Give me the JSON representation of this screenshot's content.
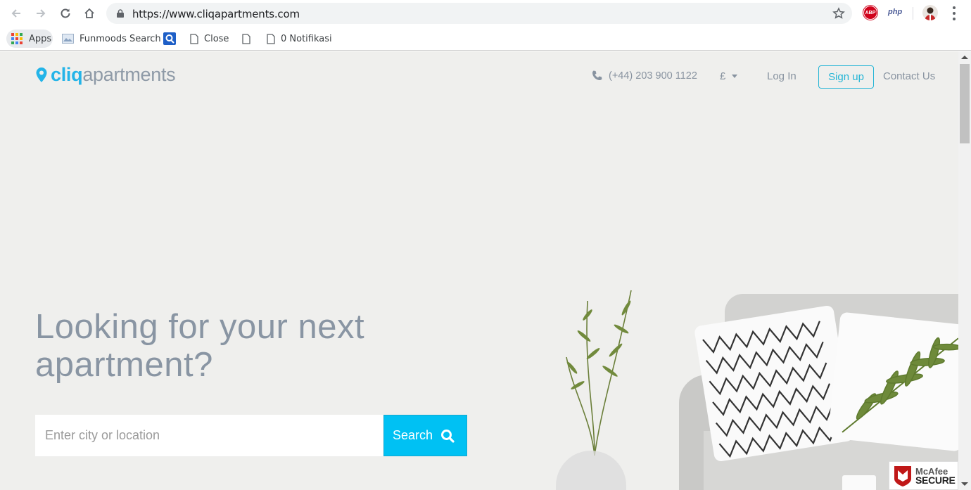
{
  "browser": {
    "url": "https://www.cliqapartments.com",
    "extensions": {
      "abp": "ABP",
      "php": "php"
    }
  },
  "bookmarks": {
    "apps": "Apps",
    "items": [
      "Funmoods Search",
      "Close",
      "",
      "0 Notifikasi"
    ]
  },
  "header": {
    "logo_part1": "cliq",
    "logo_part2": "apartments",
    "phone": "(+44) 203 900 1122",
    "currency": "£",
    "login": "Log In",
    "signup": "Sign up",
    "contact": "Contact Us"
  },
  "hero": {
    "headline_line1": "Looking for your next",
    "headline_line2": "apartment?",
    "search_placeholder": "Enter city or location",
    "search_button": "Search"
  },
  "badge": {
    "line1": "McAfee",
    "line2": "SECURE"
  },
  "colors": {
    "accent": "#00c1f3",
    "logo_blue": "#24b4e8",
    "text_gray": "#8995a3"
  }
}
